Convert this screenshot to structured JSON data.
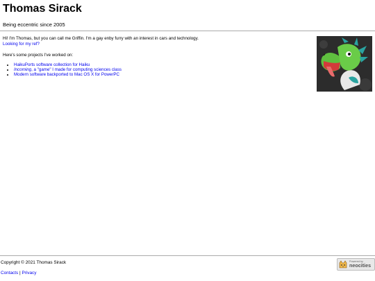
{
  "header": {
    "title": "Thomas Sirack",
    "tagline": "Being eccentric since 2005"
  },
  "intro": {
    "text": "Hi! I'm Thomas, but you can call me Griffin. I'm a gay enby furry with an interest in cars and technology.",
    "ref_link": "Looking for my ref?"
  },
  "projects": {
    "heading": "Here's some projects I've worked on:",
    "items": [
      {
        "label": "HaikuPorts software collection for Haiku"
      },
      {
        "emphasis": "Incoming",
        "label": ", a \"game\" I made for computing sciences class"
      },
      {
        "label": "Modern software backported to Mac OS X for PowerPC"
      }
    ]
  },
  "footer": {
    "copyright": "Copyright © 2021 Thomas Sirack",
    "contacts": "Contacts",
    "separator": "|",
    "privacy": "Privacy"
  },
  "badge": {
    "small": "Powered by",
    "big": "neocities",
    "icon": "neocities-cat-icon"
  },
  "avatar": {
    "icon": "green-dragon-avatar-icon",
    "colors": {
      "bg": "#2c2c2c",
      "body": "#5fbf3f",
      "mouth": "#d33a3a",
      "mane": "#2aa3a0"
    }
  }
}
